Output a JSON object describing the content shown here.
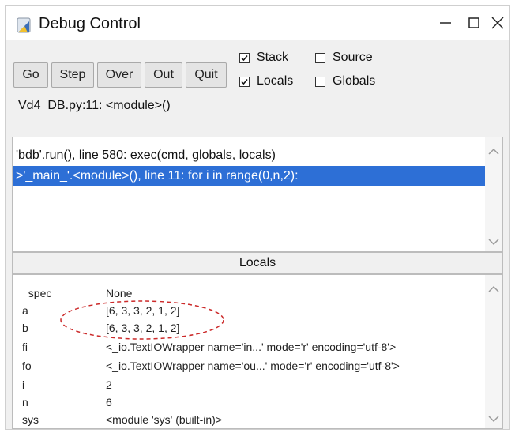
{
  "window": {
    "title": "Debug Control",
    "icons": {
      "app": "python-icon",
      "minimize": "minimize-icon",
      "maximize": "maximize-icon",
      "close": "close-icon"
    }
  },
  "toolbar": {
    "buttons": [
      "Go",
      "Step",
      "Over",
      "Out",
      "Quit"
    ]
  },
  "options": {
    "stack": {
      "label": "Stack",
      "checked": true
    },
    "locals": {
      "label": "Locals",
      "checked": true
    },
    "source": {
      "label": "Source",
      "checked": false
    },
    "globals": {
      "label": "Globals",
      "checked": false
    }
  },
  "status": "Vd4_DB.py:11: <module>()",
  "stack": {
    "lines": [
      "'bdb'.run(), line 580: exec(cmd, globals, locals)",
      ">'_main_'.<module>(), line 11: for i in range(0,n,2):"
    ],
    "selected_index": 1
  },
  "locals": {
    "header": "Locals",
    "rows": [
      {
        "name": "_spec_",
        "value": "None"
      },
      {
        "name": "a",
        "value": "[6, 3, 3, 2, 1, 2]"
      },
      {
        "name": "b",
        "value": "[6, 3, 3, 2, 1, 2]"
      },
      {
        "name": "fi",
        "value": "<_io.TextIOWrapper name='in...' mode='r' encoding='utf-8'>"
      },
      {
        "name": "fo",
        "value": "<_io.TextIOWrapper name='ou...' mode='r' encoding='utf-8'>"
      },
      {
        "name": "i",
        "value": "2"
      },
      {
        "name": "n",
        "value": "6"
      },
      {
        "name": "sys",
        "value": "<module 'sys' (built-in)>"
      }
    ]
  },
  "colors": {
    "selection": "#2d6fd6",
    "annotation": "#cc2a2a",
    "window_bg": "#f0f0f0"
  }
}
